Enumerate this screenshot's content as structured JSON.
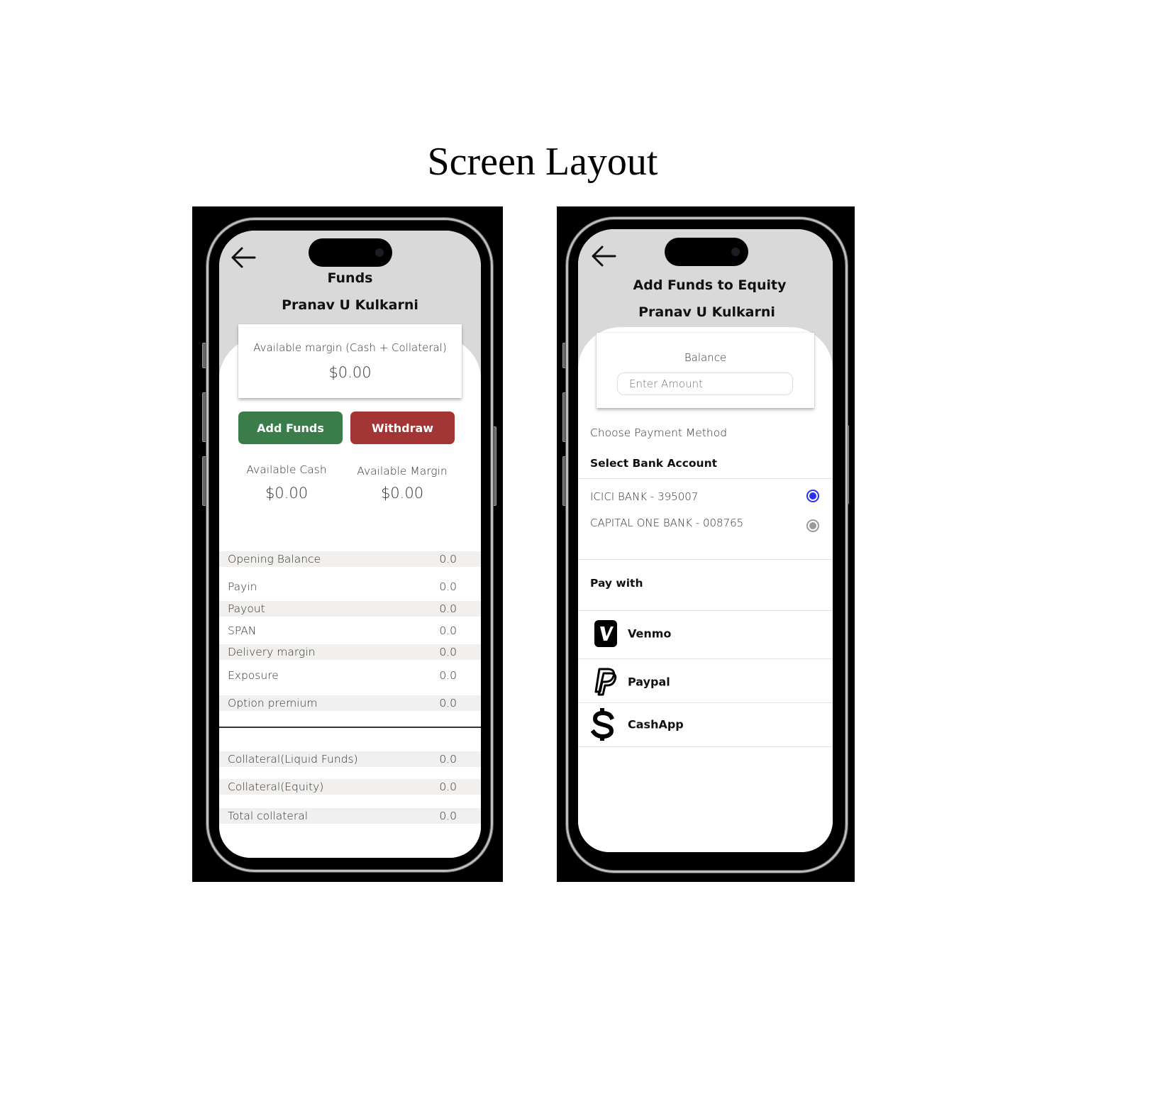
{
  "page": {
    "title": "Screen Layout"
  },
  "funds_screen": {
    "title": "Funds",
    "user_name": "Pranav U Kulkarni",
    "margin_card": {
      "label": "Available margin (Cash + Collateral)",
      "value": "$0.00"
    },
    "buttons": {
      "add_funds": "Add Funds",
      "withdraw": "Withdraw",
      "add_color": "#3a7d4a",
      "withdraw_color": "#a33535"
    },
    "summary": [
      {
        "label": "Available Cash",
        "value": "$0.00"
      },
      {
        "label": "Available Margin",
        "value": "$0.00"
      }
    ],
    "ledger": [
      {
        "label": "Opening Balance",
        "value": "0.0"
      },
      {
        "label": "Payin",
        "value": "0.0"
      },
      {
        "label": "Payout",
        "value": "0.0"
      },
      {
        "label": "SPAN",
        "value": "0.0"
      },
      {
        "label": "Delivery margin",
        "value": "0.0"
      },
      {
        "label": "Exposure",
        "value": "0.0"
      },
      {
        "label": "Option premium",
        "value": "0.0"
      }
    ],
    "collateral": [
      {
        "label": "Collateral(Liquid  Funds)",
        "value": "0.0"
      },
      {
        "label": "Collateral(Equity)",
        "value": "0.0"
      },
      {
        "label": "Total collateral",
        "value": "0.0"
      }
    ]
  },
  "add_funds_screen": {
    "title": "Add Funds to Equity",
    "user_name": "Pranav U Kulkarni",
    "balance_label": "Balance",
    "amount_input": {
      "placeholder": "Enter Amount",
      "value": ""
    },
    "choose_method_label": "Choose Payment Method",
    "select_bank_label": "Select Bank Account",
    "banks": [
      {
        "name": "ICICI BANK - 395007",
        "selected": true
      },
      {
        "name": "CAPITAL ONE BANK - 008765",
        "selected": false
      }
    ],
    "radio_selected_color": "#2a2ff0",
    "radio_unselected_color": "#9a9a9a",
    "pay_with_label": "Pay with",
    "payment_options": [
      {
        "name": "Venmo",
        "icon": "venmo-icon"
      },
      {
        "name": "Paypal",
        "icon": "paypal-icon"
      },
      {
        "name": "CashApp",
        "icon": "cashapp-icon"
      }
    ]
  }
}
